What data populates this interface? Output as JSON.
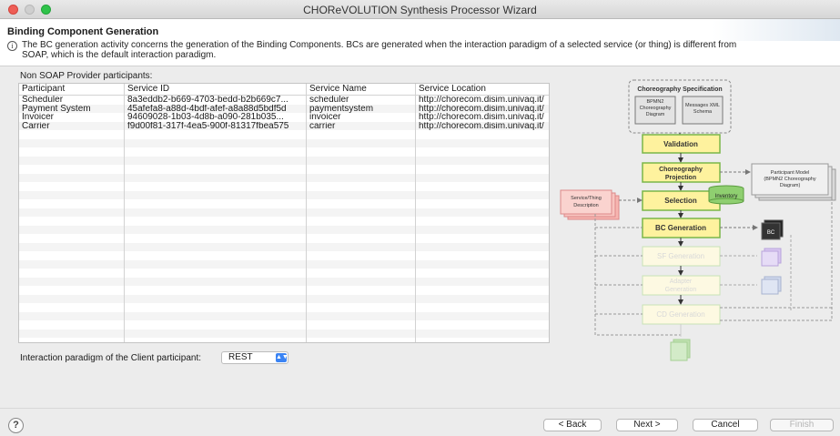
{
  "window": {
    "title": "CHOReVOLUTION Synthesis Processor Wizard"
  },
  "header": {
    "title": "Binding Component Generation",
    "description": "The BC generation activity concerns the generation of the Binding Components. BCs are generated when the interaction paradigm of a selected service (or thing) is different from SOAP, which is the default interaction paradigm."
  },
  "section_label": "Non SOAP Provider participants:",
  "table": {
    "columns": [
      "Participant",
      "Service ID",
      "Service Name",
      "Service Location"
    ],
    "rows": [
      [
        "Scheduler",
        "8a3eddb2-b669-4703-bedd-b2b669c7...",
        "scheduler",
        "http://chorecom.disim.univaq.it/"
      ],
      [
        "Payment System",
        "45afefa8-a88d-4bdf-afef-a8a88d5bdf5d",
        "paymentsystem",
        "http://chorecom.disim.univaq.it/"
      ],
      [
        "Invoicer",
        "94609028-1b03-4d8b-a090-281b035...",
        "invoicer",
        "http://chorecom.disim.univaq.it/"
      ],
      [
        "Carrier",
        "f9d00f81-317f-4ea5-900f-81317fbea575",
        "carrier",
        "http://chorecom.disim.univaq.it/"
      ]
    ]
  },
  "paradigm": {
    "label": "Interaction paradigm of the Client participant:",
    "value": "REST"
  },
  "diagram": {
    "spec_title": "Choreography Specification",
    "bpmn": [
      "BPMN2",
      "Choreography",
      "Diagram"
    ],
    "msg_xml": [
      "Messages XML",
      "Schema"
    ],
    "validation": "Validation",
    "projection": [
      "Choreography",
      "Projection"
    ],
    "participant_model": [
      "Participant Model",
      "(BPMN2 Choreography",
      "Diagram)"
    ],
    "service_desc": [
      "Service/Thing",
      "Description"
    ],
    "selection": "Selection",
    "inventory": "Inventory",
    "bc_generation": "BC Generation",
    "bc_label": "BC",
    "sf_generation": "SF Generation",
    "adapter_generation": [
      "Adapter",
      "Generation"
    ],
    "cd_generation": "CD Generation"
  },
  "buttons": {
    "back": "< Back",
    "next": "Next >",
    "cancel": "Cancel",
    "finish": "Finish",
    "help": "?"
  },
  "colors": {
    "accent": "#3b84f4",
    "stage_fill": "#fef29e",
    "stage_border": "#7ab648",
    "service_pink": "#f6b5b0"
  }
}
